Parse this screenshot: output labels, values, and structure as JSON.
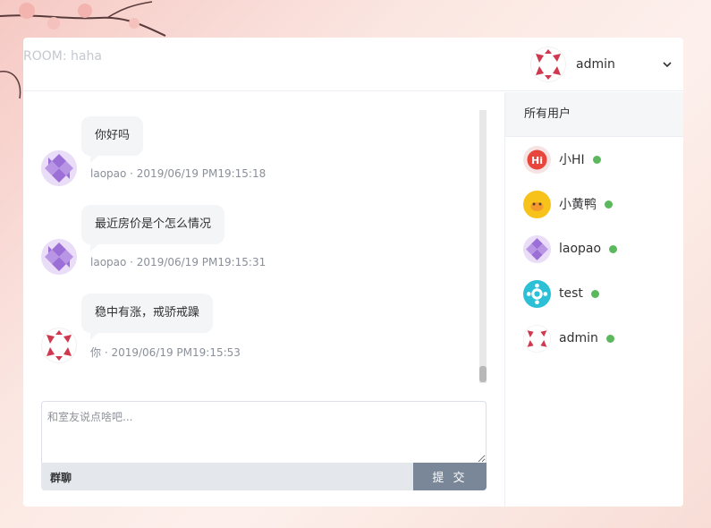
{
  "room": {
    "title": "ROOM: haha"
  },
  "current_user": {
    "name": "admin",
    "avatar_icon": "geometric-avatar-red-icon",
    "menu_icon": "chevron-down-icon"
  },
  "messages": [
    {
      "text": "你好吗",
      "sender": "laopao",
      "time": "2019/06/19 PM19:15:18",
      "meta": "laopao · 2019/06/19 PM19:15:18",
      "avatar_icon": "geometric-avatar-purple-icon"
    },
    {
      "text": "最近房价是个怎么情况",
      "sender": "laopao",
      "time": "2019/06/19 PM19:15:31",
      "meta": "laopao · 2019/06/19 PM19:15:31",
      "avatar_icon": "geometric-avatar-purple-icon"
    },
    {
      "text": "稳中有涨，戒骄戒躁",
      "sender": "你",
      "time": "2019/06/19 PM19:15:53",
      "meta": "你 · 2019/06/19 PM19:15:53",
      "avatar_icon": "geometric-avatar-red-icon"
    }
  ],
  "input": {
    "placeholder": "和室友说点啥吧...",
    "value": ""
  },
  "composer": {
    "mode_label": "群聊",
    "submit_label": "提 交"
  },
  "sidebar": {
    "title": "所有用户",
    "users": [
      {
        "name": "小HI",
        "status": "online",
        "avatar_icon": "hi-logo-avatar-icon"
      },
      {
        "name": "小黄鸭",
        "status": "online",
        "avatar_icon": "yellow-duck-avatar-icon"
      },
      {
        "name": "laopao",
        "status": "online",
        "avatar_icon": "geometric-avatar-purple-icon"
      },
      {
        "name": "test",
        "status": "online",
        "avatar_icon": "geometric-avatar-cyan-icon"
      },
      {
        "name": "admin",
        "status": "online",
        "avatar_icon": "geometric-avatar-red-icon"
      }
    ]
  },
  "colors": {
    "online": "#5cb85c",
    "submit": "#7a8799",
    "bubble": "#f4f5f7",
    "avatar_red": "#d0384f",
    "avatar_purple": "#9b6fd6",
    "avatar_cyan": "#2bc0d6"
  }
}
